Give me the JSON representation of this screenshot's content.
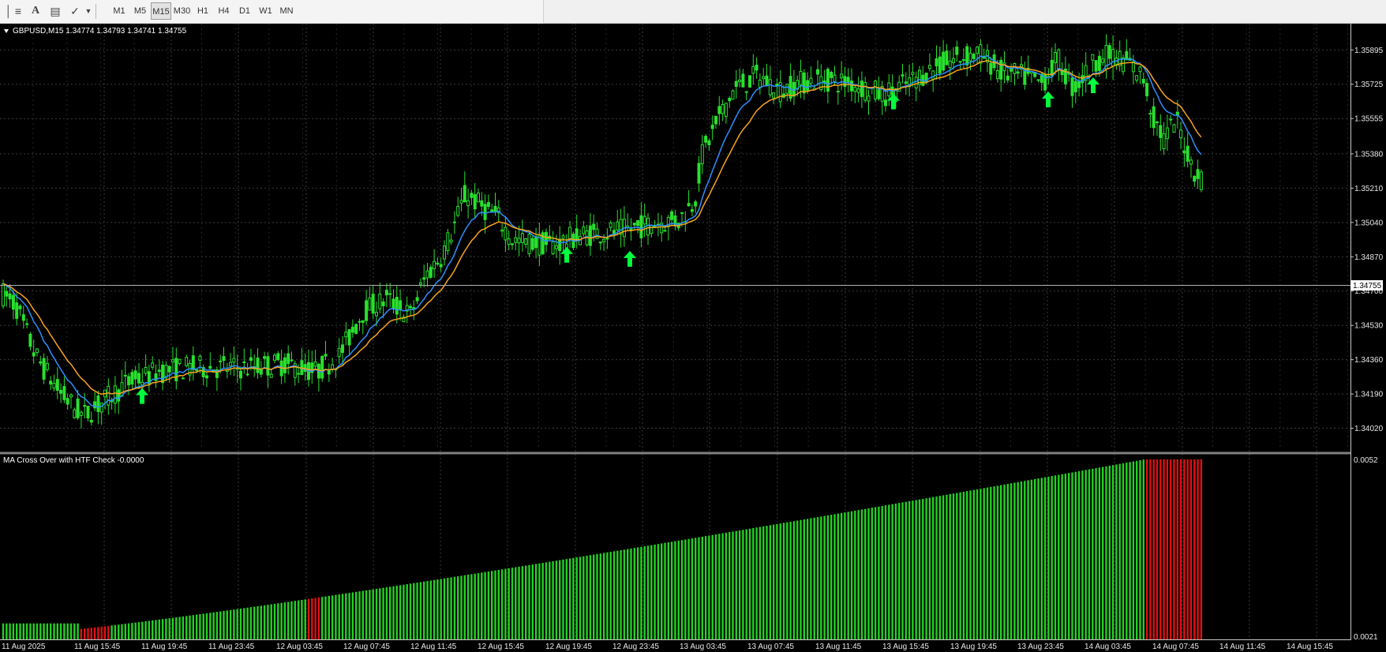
{
  "toolbar": {
    "timeframes": [
      "M1",
      "M5",
      "M15",
      "M30",
      "H1",
      "H4",
      "D1",
      "W1",
      "MN"
    ],
    "active_timeframe": "M15"
  },
  "main_chart": {
    "symbol_info": "GBPUSD,M15  1.34774 1.34793 1.34741 1.34755",
    "price_labels": [
      "1.35895",
      "1.35725",
      "1.35555",
      "1.35380",
      "1.35210",
      "1.35040",
      "1.34870",
      "1.34700",
      "1.34530",
      "1.34360",
      "1.34190",
      "1.34020"
    ],
    "current_price": "1.34755"
  },
  "indicator": {
    "title": "MA Cross Over with HTF Check -0.0000",
    "scale_labels": [
      "0.0052",
      "0.0021"
    ]
  },
  "time_labels": [
    "11 Aug 2025",
    "11 Aug 15:45",
    "11 Aug 19:45",
    "11 Aug 23:45",
    "12 Aug 03:45",
    "12 Aug 07:45",
    "12 Aug 11:45",
    "12 Aug 15:45",
    "12 Aug 19:45",
    "12 Aug 23:45",
    "13 Aug 03:45",
    "13 Aug 07:45",
    "13 Aug 11:45",
    "13 Aug 15:45",
    "13 Aug 19:45",
    "13 Aug 23:45",
    "14 Aug 03:45",
    "14 Aug 07:45",
    "14 Aug 11:45",
    "14 Aug 15:45"
  ],
  "chart_data": {
    "type": "candlestick",
    "symbol": "GBPUSD",
    "timeframe": "M15",
    "y_range": [
      1.3394,
      1.3599
    ],
    "price_path": [
      [
        0,
        1.347
      ],
      [
        20,
        1.3463
      ],
      [
        45,
        1.3438
      ],
      [
        75,
        1.342
      ],
      [
        105,
        1.3408
      ],
      [
        130,
        1.3415
      ],
      [
        160,
        1.3424
      ],
      [
        200,
        1.343
      ],
      [
        240,
        1.3432
      ],
      [
        280,
        1.3432
      ],
      [
        320,
        1.3432
      ],
      [
        360,
        1.3434
      ],
      [
        400,
        1.343
      ],
      [
        430,
        1.3438
      ],
      [
        460,
        1.346
      ],
      [
        490,
        1.3466
      ],
      [
        520,
        1.3458
      ],
      [
        540,
        1.3478
      ],
      [
        560,
        1.3488
      ],
      [
        575,
        1.3502
      ],
      [
        590,
        1.3518
      ],
      [
        610,
        1.3512
      ],
      [
        630,
        1.3507
      ],
      [
        650,
        1.3495
      ],
      [
        700,
        1.3493
      ],
      [
        740,
        1.3498
      ],
      [
        790,
        1.35
      ],
      [
        830,
        1.3504
      ],
      [
        860,
        1.3505
      ],
      [
        880,
        1.3515
      ],
      [
        890,
        1.3538
      ],
      [
        910,
        1.3555
      ],
      [
        930,
        1.357
      ],
      [
        960,
        1.3577
      ],
      [
        990,
        1.3569
      ],
      [
        1010,
        1.3573
      ],
      [
        1040,
        1.3575
      ],
      [
        1080,
        1.3573
      ],
      [
        1120,
        1.3567
      ],
      [
        1150,
        1.3573
      ],
      [
        1180,
        1.358
      ],
      [
        1210,
        1.3585
      ],
      [
        1240,
        1.3588
      ],
      [
        1270,
        1.3578
      ],
      [
        1300,
        1.3576
      ],
      [
        1320,
        1.3573
      ],
      [
        1340,
        1.3585
      ],
      [
        1360,
        1.357
      ],
      [
        1390,
        1.3585
      ],
      [
        1410,
        1.3587
      ],
      [
        1430,
        1.3583
      ],
      [
        1450,
        1.3575
      ],
      [
        1460,
        1.3557
      ],
      [
        1475,
        1.3545
      ],
      [
        1490,
        1.3555
      ],
      [
        1510,
        1.3532
      ],
      [
        1525,
        1.3524
      ]
    ],
    "moving_averages": [
      {
        "color": "#2e8fff"
      },
      {
        "color": "#f7a31c"
      }
    ],
    "buy_arrows": [
      [
        180,
        1.3418
      ],
      [
        718,
        1.3488
      ],
      [
        798,
        1.3486
      ],
      [
        1132,
        1.3564
      ],
      [
        1328,
        1.3565
      ],
      [
        1385,
        1.3572
      ]
    ],
    "indicator_histogram": {
      "range": [
        0.0021,
        0.0052
      ],
      "red_spans": [
        [
          100,
          140
        ],
        [
          387,
          405
        ],
        [
          1453,
          1527
        ]
      ]
    }
  }
}
